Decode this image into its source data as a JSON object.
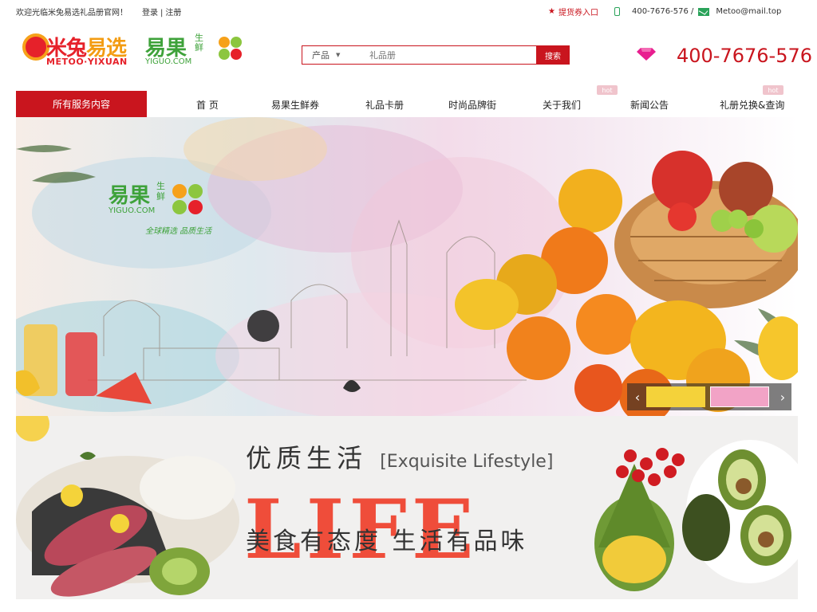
{
  "topbar": {
    "welcome": "欢迎光临米兔易选礼品册官网！",
    "login": "登录",
    "register": "注册",
    "separator": "|",
    "entry": "提货券入口",
    "phone": "400-7676-576 /",
    "email": "Metoo@mail.top"
  },
  "logos": {
    "metoo_cn_a": "米兔",
    "metoo_cn_b": "易选",
    "metoo_en": "METOO·YIXUAN",
    "yiguo_cn": "易果",
    "yiguo_side": "生鲜",
    "yiguo_en": "YIGUO.COM"
  },
  "search": {
    "category": "产品",
    "placeholder": "礼品册",
    "button": "搜索"
  },
  "hotline": "400-7676-576",
  "nav": {
    "all": "所有服务内容",
    "items": [
      "首 页",
      "易果生鲜券",
      "礼品卡册",
      "时尚品牌街",
      "关于我们",
      "新闻公告",
      "礼册兑换&查询"
    ],
    "hot_label": "hot"
  },
  "banner1": {
    "brand_cn": "易果",
    "brand_side": "生鲜",
    "brand_en": "YIGUO.COM",
    "slogan": "全球精选 品质生活"
  },
  "banner2": {
    "title_cn": "优质生活",
    "title_en": "[Exquisite Lifestyle]",
    "big": "LIFE",
    "subtitle": "美食有态度 生活有品味"
  },
  "colors": {
    "brand_red": "#c9151e",
    "green": "#3ea23a",
    "life_red": "#ef4d3a"
  }
}
